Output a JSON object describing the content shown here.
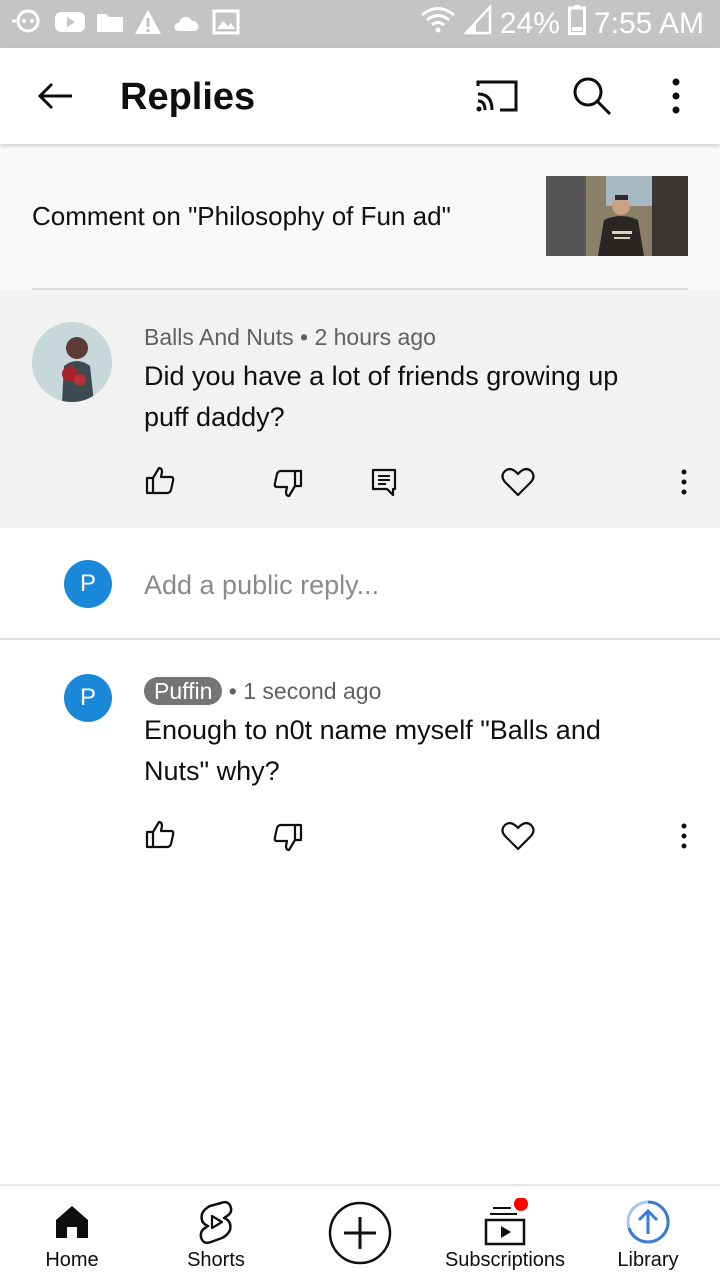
{
  "status_bar": {
    "battery": "24%",
    "time": "7:55 AM",
    "icons": [
      "hangouts-icon",
      "youtube-icon",
      "folder-icon",
      "warning-icon",
      "cloud-icon",
      "image-icon",
      "wifi-icon",
      "signal-icon",
      "battery-icon"
    ]
  },
  "app_bar": {
    "title": "Replies",
    "icons": [
      "back-arrow-icon",
      "cast-icon",
      "search-icon",
      "more-vert-icon"
    ]
  },
  "context": {
    "text": "Comment on \"Philosophy of Fun ad\""
  },
  "main_comment": {
    "author": "Balls And Nuts",
    "separator": "•",
    "time": "2 hours ago",
    "text": "Did you have a lot of friends growing up puff daddy?",
    "actions": [
      "like-icon",
      "dislike-icon",
      "reply-icon",
      "heart-icon",
      "more-vert-icon"
    ]
  },
  "reply_input": {
    "avatar_letter": "P",
    "placeholder": "Add a public reply..."
  },
  "reply": {
    "avatar_letter": "P",
    "author": "Puffin",
    "separator": "•",
    "time": "1 second ago",
    "text": "Enough to n0t name myself \"Balls and Nuts\" why?",
    "actions": [
      "like-icon",
      "dislike-icon",
      "heart-icon",
      "more-vert-icon"
    ]
  },
  "bottom_nav": {
    "items": [
      {
        "label": "Home",
        "icon": "home-icon"
      },
      {
        "label": "Shorts",
        "icon": "shorts-icon"
      },
      {
        "label": "",
        "icon": "create-icon"
      },
      {
        "label": "Subscriptions",
        "icon": "subscriptions-icon"
      },
      {
        "label": "Library",
        "icon": "library-icon"
      }
    ]
  },
  "colors": {
    "status_bar_bg": "#c4c4c4",
    "avatar_p": "#1a88d8",
    "notification_dot": "#ff0000",
    "library_accent": "#3a7bd5"
  }
}
